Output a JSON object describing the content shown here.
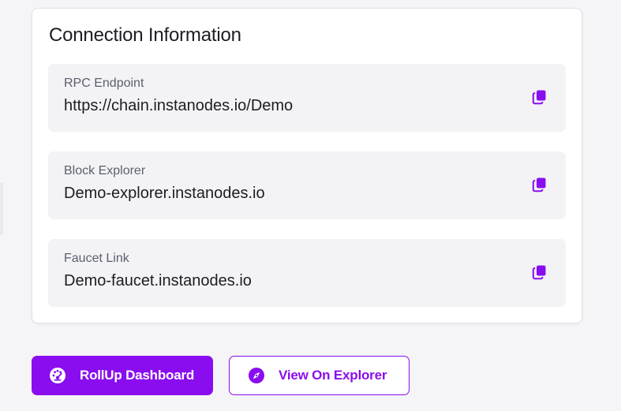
{
  "connection": {
    "title": "Connection Information",
    "items": [
      {
        "label": "RPC Endpoint",
        "value": "https://chain.instanodes.io/Demo",
        "icon": "copy-icon"
      },
      {
        "label": "Block Explorer",
        "value": "Demo-explorer.instanodes.io",
        "icon": "copy-icon"
      },
      {
        "label": "Faucet Link",
        "value": "Demo-faucet.instanodes.io",
        "icon": "copy-icon"
      }
    ]
  },
  "actions": {
    "dashboard_label": "RollUp Dashboard",
    "dashboard_icon": "dashboard-gauge-icon",
    "explorer_label": "View On Explorer",
    "explorer_icon": "compass-icon"
  },
  "colors": {
    "accent": "#8a0df0",
    "row_background": "#f3f3f6",
    "page_background": "#f5f5f7"
  }
}
